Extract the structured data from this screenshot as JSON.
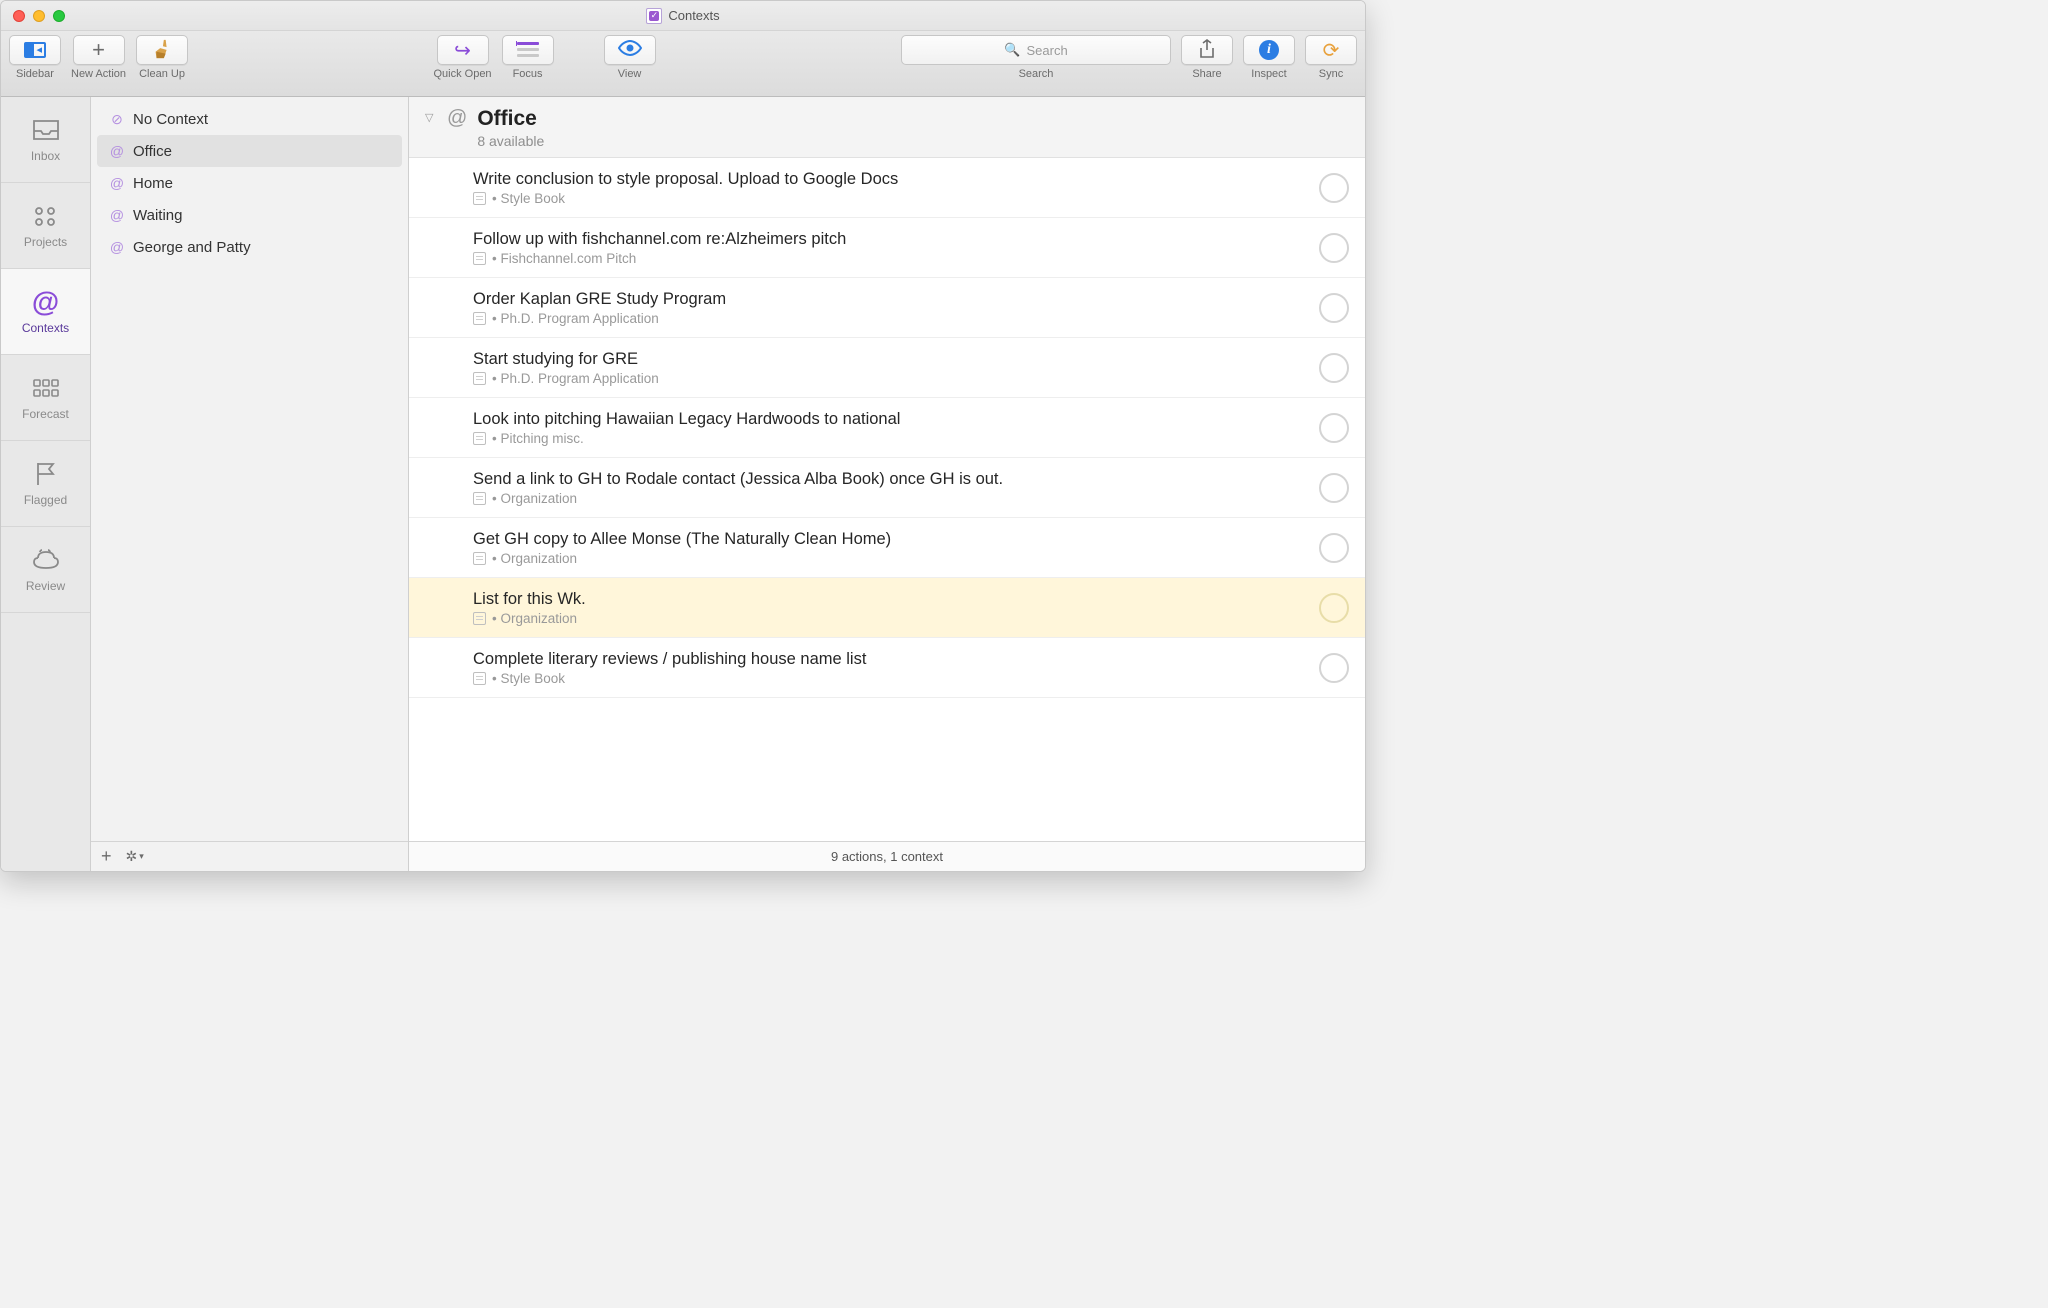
{
  "window": {
    "title": "Contexts"
  },
  "toolbar": {
    "sidebar": "Sidebar",
    "new_action": "New Action",
    "clean_up": "Clean Up",
    "quick_open": "Quick Open",
    "focus": "Focus",
    "view": "View",
    "search_label": "Search",
    "search_placeholder": "Search",
    "share": "Share",
    "inspect": "Inspect",
    "sync": "Sync"
  },
  "perspectives": [
    {
      "id": "inbox",
      "label": "Inbox",
      "selected": false
    },
    {
      "id": "projects",
      "label": "Projects",
      "selected": false
    },
    {
      "id": "contexts",
      "label": "Contexts",
      "selected": true
    },
    {
      "id": "forecast",
      "label": "Forecast",
      "selected": false
    },
    {
      "id": "flagged",
      "label": "Flagged",
      "selected": false
    },
    {
      "id": "review",
      "label": "Review",
      "selected": false
    }
  ],
  "contexts": [
    {
      "label": "No Context",
      "kind": "none",
      "selected": false
    },
    {
      "label": "Office",
      "kind": "at",
      "selected": true
    },
    {
      "label": "Home",
      "kind": "at",
      "selected": false
    },
    {
      "label": "Waiting",
      "kind": "at",
      "selected": false
    },
    {
      "label": "George and Patty",
      "kind": "at",
      "selected": false
    }
  ],
  "header": {
    "title": "Office",
    "subtitle": "8 available"
  },
  "tasks": [
    {
      "title": "Write conclusion to style proposal. Upload to Google Docs",
      "project": "Style Book",
      "highlight": false
    },
    {
      "title": "Follow up with fishchannel.com re:Alzheimers pitch",
      "project": "Fishchannel.com Pitch",
      "highlight": false
    },
    {
      "title": "Order Kaplan GRE Study Program",
      "project": "Ph.D. Program Application",
      "highlight": false
    },
    {
      "title": "Start studying for GRE",
      "project": "Ph.D. Program Application",
      "highlight": false
    },
    {
      "title": "Look into pitching Hawaiian Legacy Hardwoods to national",
      "project": "Pitching misc.",
      "highlight": false
    },
    {
      "title": "Send a link to GH to Rodale contact (Jessica Alba Book) once GH is out.",
      "project": "Organization",
      "highlight": false
    },
    {
      "title": "Get GH copy to Allee Monse (The Naturally Clean Home)",
      "project": "Organization",
      "highlight": false
    },
    {
      "title": "List for this Wk.",
      "project": "Organization",
      "highlight": true
    },
    {
      "title": "Complete literary reviews / publishing house name list",
      "project": "Style Book",
      "highlight": false
    }
  ],
  "status": "9 actions, 1 context"
}
